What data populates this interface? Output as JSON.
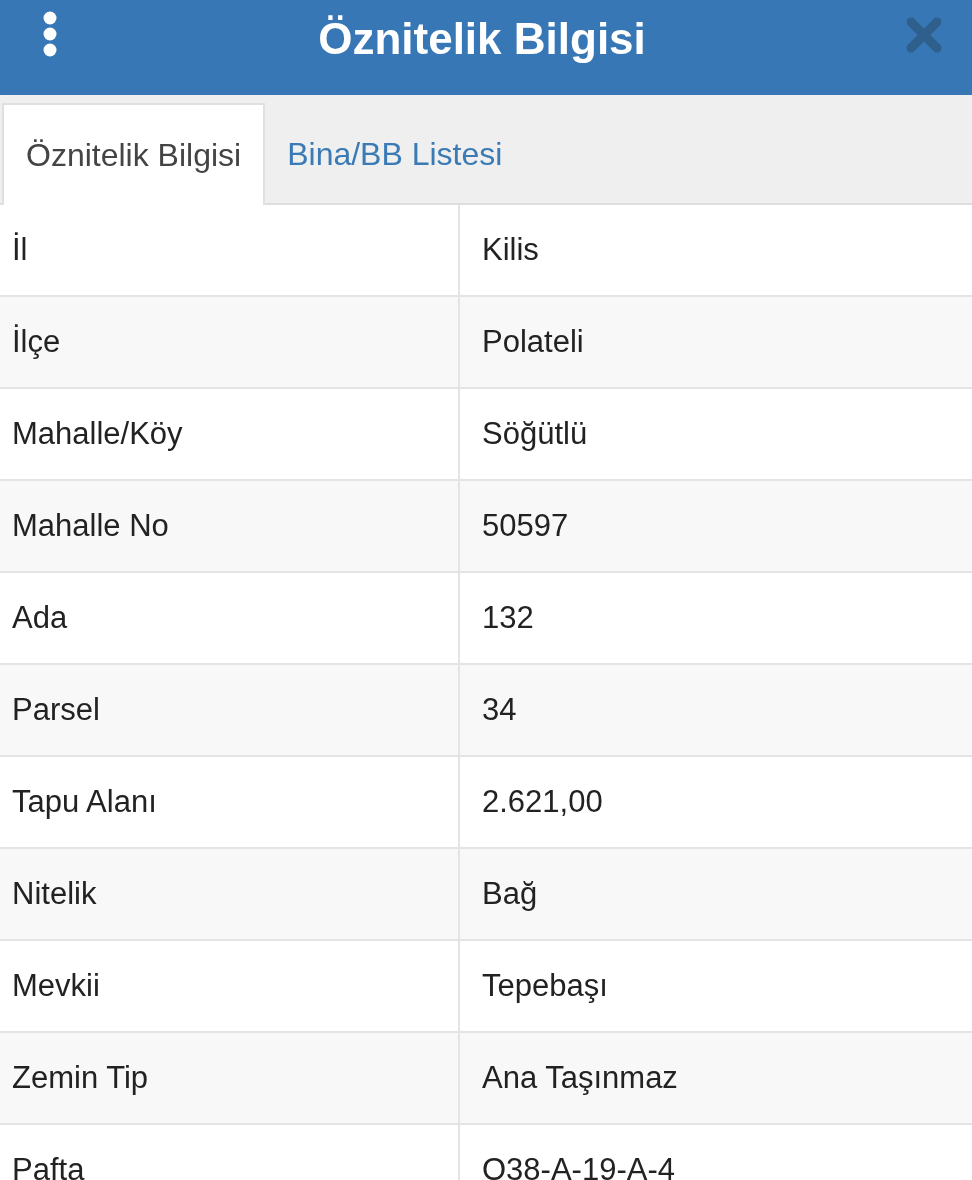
{
  "header": {
    "title": "Öznitelik Bilgisi"
  },
  "tabs": [
    {
      "label": "Öznitelik Bilgisi",
      "selected": true
    },
    {
      "label": "Bina/BB Listesi",
      "selected": false
    }
  ],
  "rows": [
    {
      "label": "İl",
      "value": "Kilis"
    },
    {
      "label": "İlçe",
      "value": "Polateli"
    },
    {
      "label": "Mahalle/Köy",
      "value": "Söğütlü"
    },
    {
      "label": "Mahalle No",
      "value": "50597"
    },
    {
      "label": "Ada",
      "value": "132"
    },
    {
      "label": "Parsel",
      "value": "34"
    },
    {
      "label": "Tapu Alanı",
      "value": "2.621,00"
    },
    {
      "label": "Nitelik",
      "value": "Bağ"
    },
    {
      "label": "Mevkii",
      "value": "Tepebaşı"
    },
    {
      "label": "Zemin Tip",
      "value": "Ana Taşınmaz"
    },
    {
      "label": "Pafta",
      "value": "O38-A-19-A-4"
    }
  ]
}
